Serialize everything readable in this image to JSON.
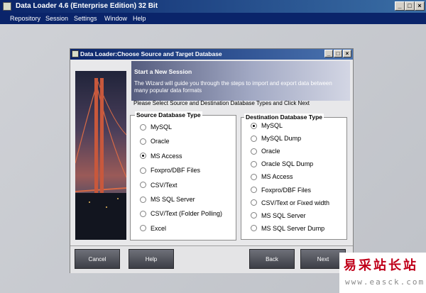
{
  "app": {
    "title": "Data Loader 4.6 (Enterprise Edition) 32 Bit",
    "window_buttons": {
      "minimize": "_",
      "maximize": "□",
      "close": "×"
    }
  },
  "menu": {
    "items": [
      "Repository",
      "Session",
      "Settings",
      "Window",
      "Help"
    ]
  },
  "dialog": {
    "title": "Data Loader:Choose Source and Target Database",
    "window_buttons": {
      "minimize": "_",
      "maximize": "□",
      "close": "×"
    },
    "welcome_title": "Start a New Session",
    "welcome_text": "The Wizard will guide you through the steps to import and export data between many popular data formats",
    "instruction": "Please Select Source and Destination Database Types and Click Next",
    "source": {
      "title": "Source Database Type",
      "selected_index": 2,
      "options": [
        "MySQL",
        "Oracle",
        "MS Access",
        "Foxpro/DBF Files",
        "CSV/Text",
        "MS SQL Server",
        "CSV/Text (Folder Polling)",
        "Excel"
      ]
    },
    "destination": {
      "title": "Destination Database Type",
      "selected_index": 0,
      "options": [
        "MySQL",
        "MySQL Dump",
        "Oracle",
        "Oracle SQL Dump",
        "MS Access",
        "Foxpro/DBF Files",
        "CSV/Text or Fixed width",
        "MS SQL Server",
        "MS SQL Server Dump"
      ]
    },
    "buttons": {
      "cancel": "Cancel",
      "help": "Help",
      "back": "Back",
      "next": "Next"
    }
  },
  "watermark": {
    "chinese": "易采站长站",
    "url": "www.easck.com"
  },
  "colors": {
    "title_bar": "#0a246a",
    "workspace": "#c7c9ce",
    "watermark_red": "#c0001a"
  }
}
